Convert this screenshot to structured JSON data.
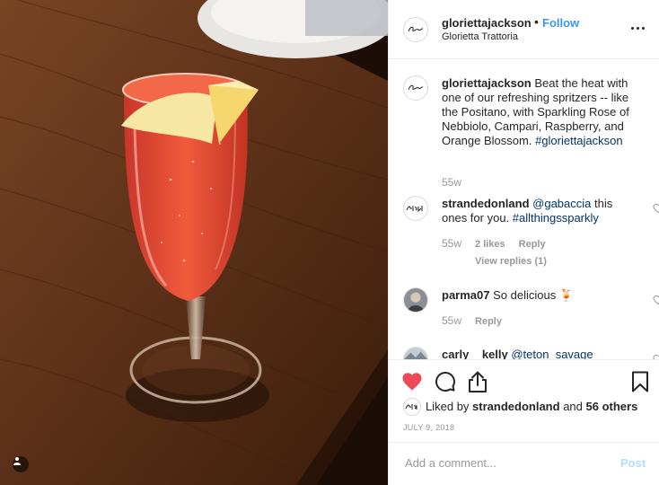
{
  "header": {
    "username": "gloriettajackson",
    "dot": "•",
    "follow_label": "Follow",
    "location": "Glorietta Trattoria",
    "avatar_icon": "glorietta-logo-icon"
  },
  "caption": {
    "username": "gloriettajackson",
    "text": "Beat the heat with one of our refreshing spritzers -- like the Positano, with Sparkling Rose of Nebbiolo, Campari, Raspberry, and Orange Blossom.",
    "hashtag": "#gloriettajackson",
    "age": "55w"
  },
  "comments": [
    {
      "username": "strandedonland",
      "mention": "@gabaccia",
      "text": "this ones for you.",
      "hashtag": "#allthingssparkly",
      "age": "55w",
      "likes": "2 likes",
      "reply_label": "Reply",
      "view_replies": "View replies (1)"
    },
    {
      "username": "parma07",
      "text": "So delicious",
      "emoji": "🍹",
      "age": "55w",
      "reply_label": "Reply"
    },
    {
      "username": "carly__kelly",
      "mention": "@teton_savage"
    }
  ],
  "actions": {
    "liked_by_prefix": "Liked by",
    "liked_by_user": "strandedonland",
    "and_label": "and",
    "others": "56 others",
    "date": "JULY 9, 2018"
  },
  "add_comment": {
    "placeholder": "Add a comment...",
    "post_label": "Post"
  },
  "colors": {
    "like_red": "#ed4956",
    "follow_blue": "#3897f0",
    "link_blue": "#003569",
    "post_disabled": "#b2dffc"
  }
}
